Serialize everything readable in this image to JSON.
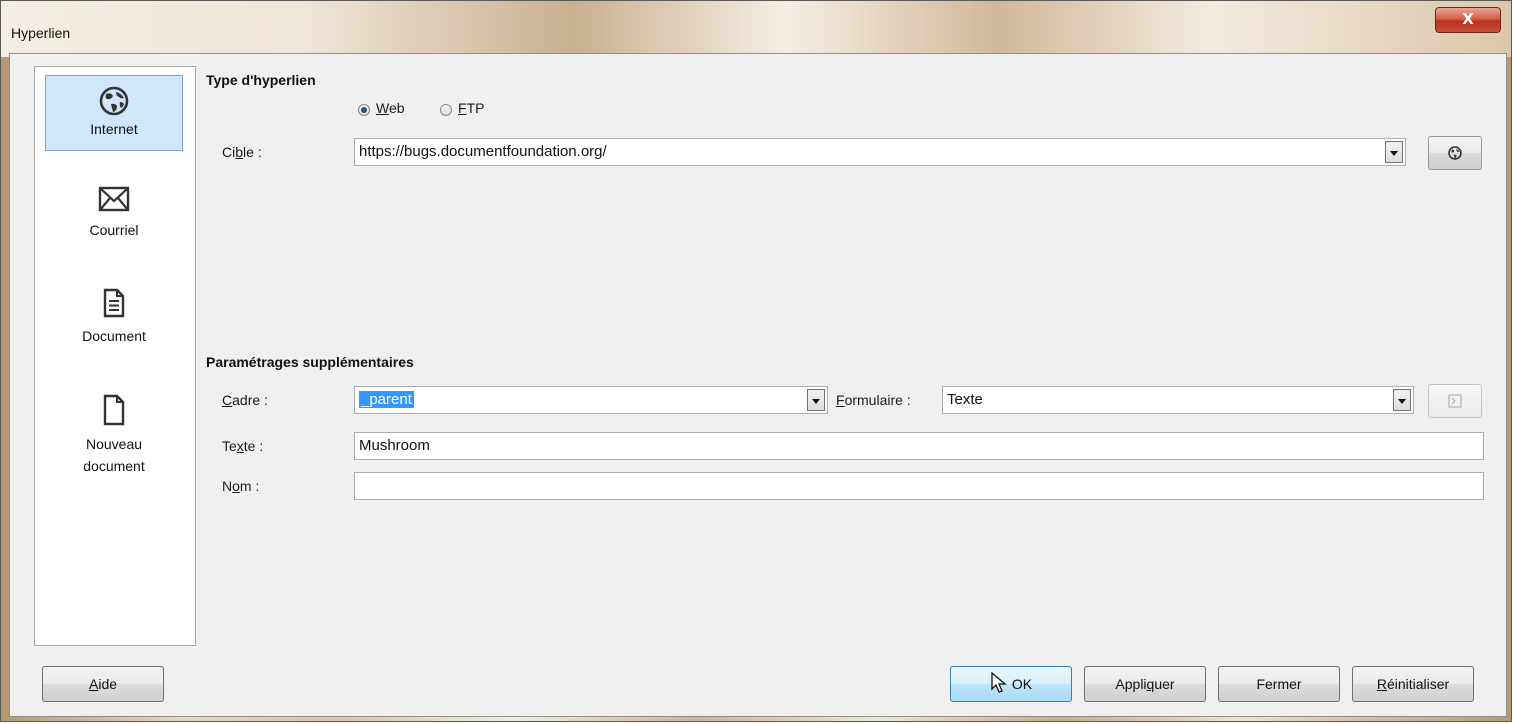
{
  "window": {
    "title": "Hyperlien",
    "close_label": "X"
  },
  "sidebar": {
    "items": [
      {
        "label": "Internet",
        "icon": "globe-icon",
        "selected": true
      },
      {
        "label": "Courriel",
        "icon": "envelope-icon"
      },
      {
        "label": "Document",
        "icon": "document-icon"
      },
      {
        "label_line1": "Nouveau",
        "label_line2": "document",
        "icon": "new-document-icon"
      }
    ]
  },
  "hyperlink_type": {
    "title": "Type d'hyperlien",
    "web_first": "W",
    "web_rest": "eb",
    "ftp_first": "F",
    "ftp_rest": "TP",
    "selected": "Web",
    "target_pre": "Ci",
    "target_u": "b",
    "target_post": "le :",
    "target_value": "https://bugs.documentfoundation.org/"
  },
  "extra": {
    "title": "Paramétrages supplémentaires",
    "frame_u": "C",
    "frame_rest": "adre :",
    "frame_value": "_parent",
    "form_u": "F",
    "form_pre": "",
    "form_rest": "ormulaire :",
    "form_value": "Texte",
    "text_pre": "Te",
    "text_u": "x",
    "text_post": "te :",
    "text_value": "Mushroom",
    "name_pre": "N",
    "name_u": "o",
    "name_post": "m :",
    "name_value": ""
  },
  "buttons": {
    "help_u": "A",
    "help_rest": "ide",
    "ok": "OK",
    "apply_pre": "Appli",
    "apply_u": "q",
    "apply_post": "uer",
    "close": "Fermer",
    "reset_u": "R",
    "reset_rest": "éinitialiser"
  },
  "colors": {
    "selection": "#3399ff",
    "selected_item_bg": "#cfe6fb",
    "close_button": "#c9503a"
  }
}
